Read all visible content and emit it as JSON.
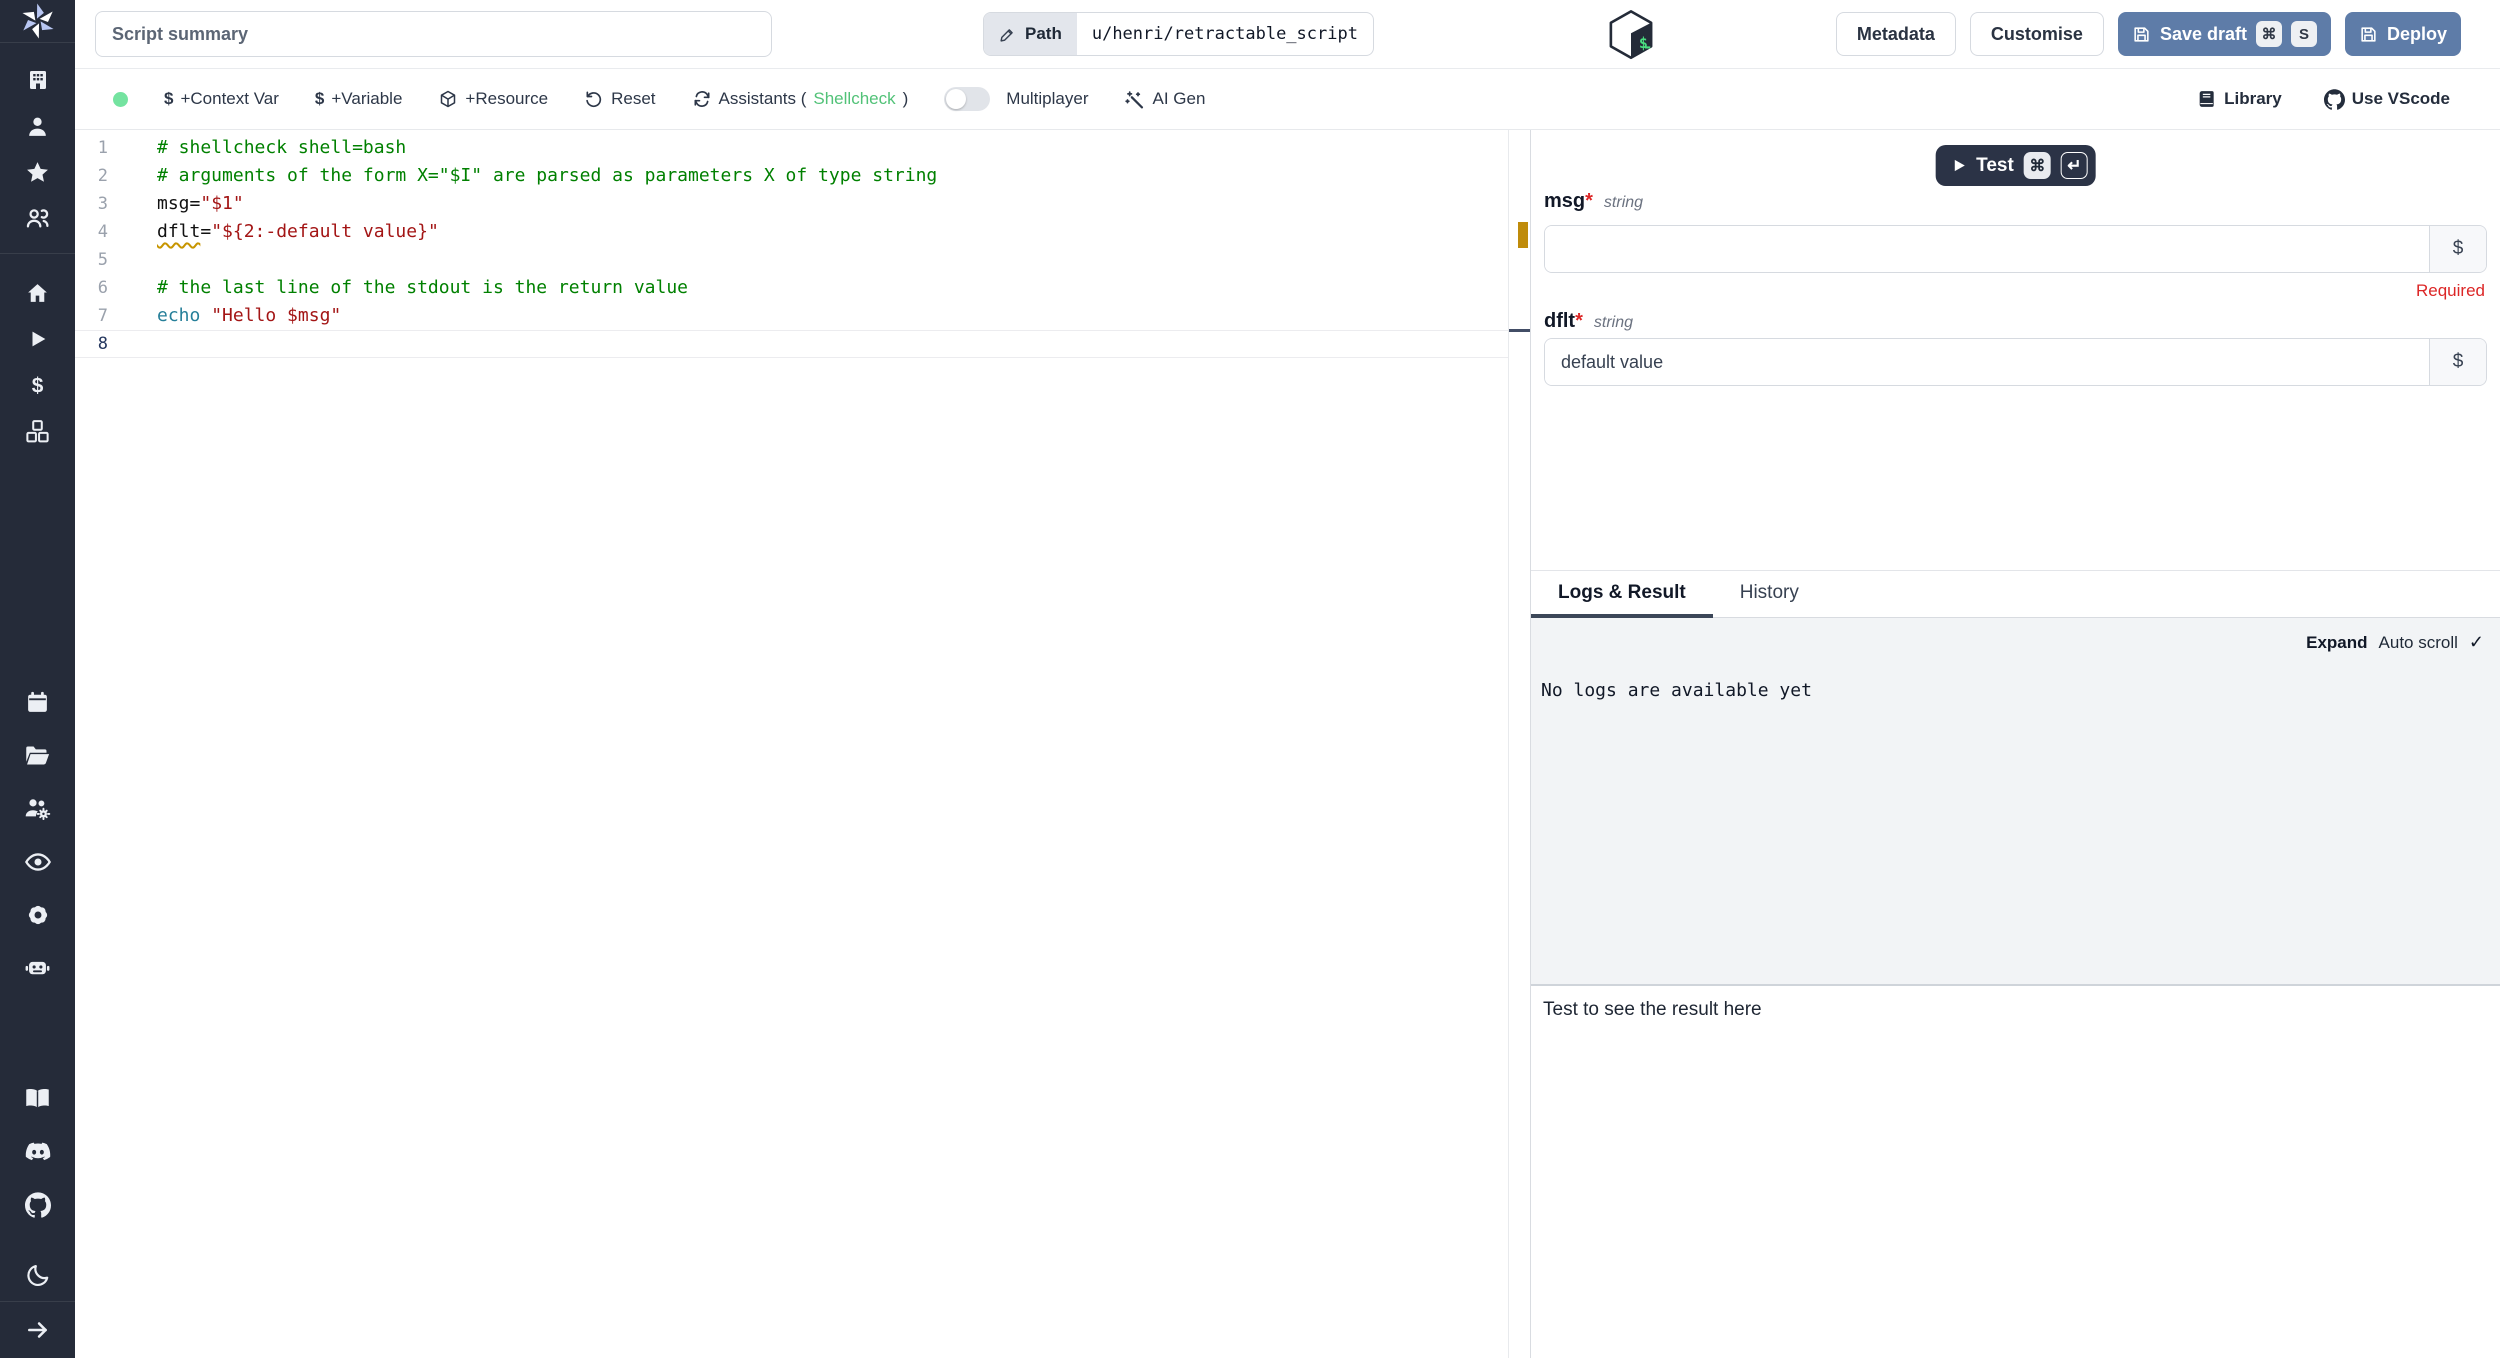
{
  "topbar": {
    "summary_placeholder": "Script summary",
    "path_label": "Path",
    "path_value": "u/henri/retractable_script",
    "language_logo": "bash-logo",
    "metadata_label": "Metadata",
    "customise_label": "Customise",
    "save_draft_label": "Save draft",
    "save_draft_keys": [
      "⌘",
      "S"
    ],
    "deploy_label": "Deploy"
  },
  "toolbar": {
    "status_dot": "green",
    "context_var_label": "+Context Var",
    "variable_label": "+Variable",
    "resource_label": "+Resource",
    "reset_label": "Reset",
    "assistants_prefix": "Assistants (",
    "assistants_highlight": "Shellcheck",
    "assistants_suffix": ")",
    "multiplayer_label": "Multiplayer",
    "ai_gen_label": "AI Gen",
    "library_label": "Library",
    "use_vscode_label": "Use VScode"
  },
  "glyphs": {
    "dollar": "$",
    "check": "✓",
    "cmd": "⌘",
    "enter": "↵"
  },
  "editor": {
    "language": "bash",
    "lines": [
      {
        "num": 1,
        "active": false,
        "tokens": [
          {
            "t": "# shellcheck shell=bash",
            "c": "comment"
          }
        ]
      },
      {
        "num": 2,
        "active": false,
        "tokens": [
          {
            "t": "# arguments of the form X=\"$I\" are parsed as parameters X of type string",
            "c": "comment"
          }
        ]
      },
      {
        "num": 3,
        "active": false,
        "tokens": [
          {
            "t": "msg=",
            "c": "plain"
          },
          {
            "t": "\"$1\"",
            "c": "string"
          }
        ]
      },
      {
        "num": 4,
        "active": false,
        "tokens": [
          {
            "t": "dflt",
            "c": "plain warn"
          },
          {
            "t": "=",
            "c": "plain"
          },
          {
            "t": "\"${2:-default value}\"",
            "c": "string"
          }
        ]
      },
      {
        "num": 5,
        "active": false,
        "tokens": []
      },
      {
        "num": 6,
        "active": false,
        "tokens": [
          {
            "t": "# the last line of the stdout is the return value",
            "c": "comment"
          }
        ]
      },
      {
        "num": 7,
        "active": false,
        "tokens": [
          {
            "t": "echo",
            "c": "builtin"
          },
          {
            "t": " ",
            "c": "plain"
          },
          {
            "t": "\"Hello $msg\"",
            "c": "string"
          }
        ]
      },
      {
        "num": 8,
        "active": true,
        "tokens": []
      }
    ]
  },
  "right_panel": {
    "test_label": "Test",
    "test_keys": [
      "⌘",
      "↵"
    ],
    "fields": [
      {
        "name": "msg",
        "required_mark": "*",
        "type": "string",
        "value": "",
        "suffix": "$",
        "error": "Required"
      },
      {
        "name": "dflt",
        "required_mark": "*",
        "type": "string",
        "value": "default value",
        "suffix": "$",
        "error": ""
      }
    ],
    "tabs": [
      "Logs & Result",
      "History"
    ],
    "active_tab": "Logs & Result",
    "expand_label": "Expand",
    "autoscroll_label": "Auto scroll",
    "no_logs_text": "No logs are available yet",
    "result_placeholder": "Test to see the result here"
  },
  "sidebar": {
    "logo": "windmill-logo",
    "groups": [
      [
        "building",
        "user",
        "star",
        "users"
      ],
      [
        "home",
        "play",
        "dollar",
        "cubes"
      ],
      [
        "calendar",
        "folder",
        "users-gear",
        "eye",
        "gear",
        "robot"
      ],
      [
        "book",
        "discord",
        "github",
        "moon"
      ]
    ],
    "expand_icon": "arrow-right"
  },
  "colors": {
    "sidebar_bg": "#252b39",
    "primary_button_blue": "#5e7ca8",
    "test_button_dark": "#2b3346",
    "status_green": "#74e3a0",
    "shellcheck_green": "#52c278",
    "required_red": "#dc2626",
    "warning_orange": "#bf8b0a",
    "comment_green": "#008000",
    "string_red": "#a31515",
    "builtin_teal": "#267f99"
  }
}
